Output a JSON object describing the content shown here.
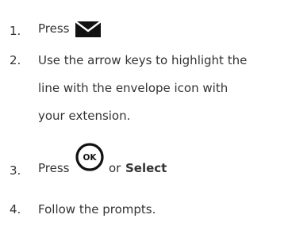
{
  "steps": [
    {
      "number": "1.",
      "text": "Press",
      "icon": "envelope-icon"
    },
    {
      "number": "2.",
      "lines": [
        "Use the arrow keys to highlight the",
        "line with the envelope icon with",
        "your extension."
      ]
    },
    {
      "number": "3.",
      "text": "Press",
      "icon": "ok-button-icon",
      "icon_label": "OK",
      "connector": "or",
      "bold_text": "Select"
    },
    {
      "number": "4.",
      "text": "Follow the prompts."
    }
  ]
}
